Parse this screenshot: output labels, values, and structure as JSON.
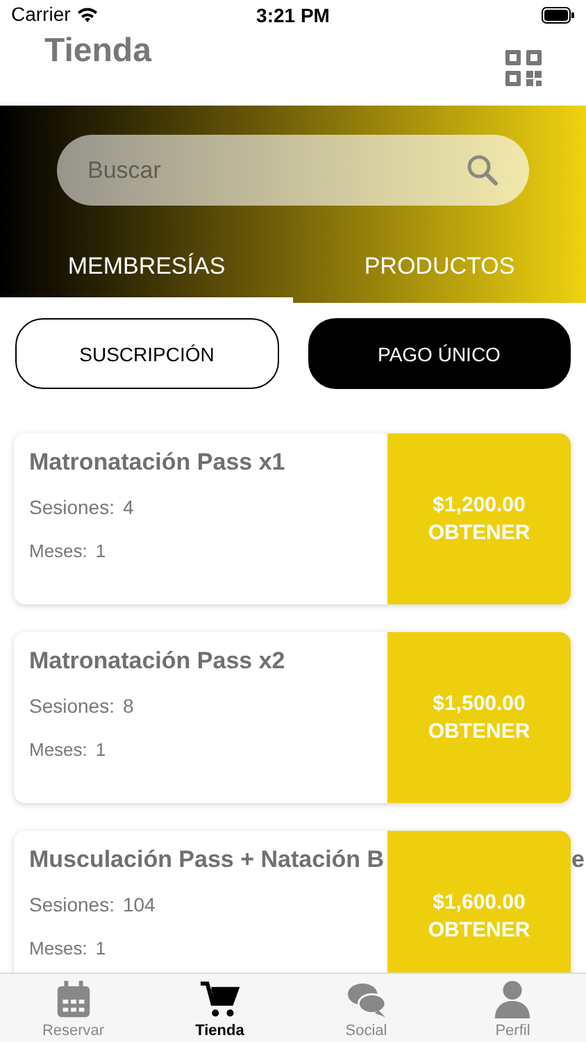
{
  "status_bar": {
    "carrier": "Carrier",
    "time": "3:21 PM"
  },
  "header": {
    "title": "Tienda"
  },
  "search": {
    "placeholder": "Buscar"
  },
  "tabs": [
    {
      "label": "MEMBRESÍAS",
      "selected": true
    },
    {
      "label": "PRODUCTOS",
      "selected": false
    }
  ],
  "plan_types": [
    {
      "label": "SUSCRIPCIÓN",
      "selected": false
    },
    {
      "label": "PAGO ÚNICO",
      "selected": true
    }
  ],
  "memberships": [
    {
      "title": "Matronatación Pass x1",
      "sessions_label": "Sesiones:",
      "sessions": "4",
      "months_label": "Meses:",
      "months": "1",
      "price": "$1,200.00",
      "action": "OBTENER"
    },
    {
      "title": "Matronatación Pass x2",
      "sessions_label": "Sesiones:",
      "sessions": "8",
      "months_label": "Meses:",
      "months": "1",
      "price": "$1,500.00",
      "action": "OBTENER"
    },
    {
      "title": "Musculación Pass + Natación B",
      "title_tail": "e",
      "sessions_label": "Sesiones:",
      "sessions": "104",
      "months_label": "Meses:",
      "months": "1",
      "price": "$1,600.00",
      "action": "OBTENER"
    }
  ],
  "bottom_nav": [
    {
      "kind": "calendar",
      "label": "Reservar",
      "selected": false
    },
    {
      "kind": "cart",
      "label": "Tienda",
      "selected": true
    },
    {
      "kind": "chat",
      "label": "Social",
      "selected": false
    },
    {
      "kind": "person",
      "label": "Perfil",
      "selected": false
    }
  ]
}
